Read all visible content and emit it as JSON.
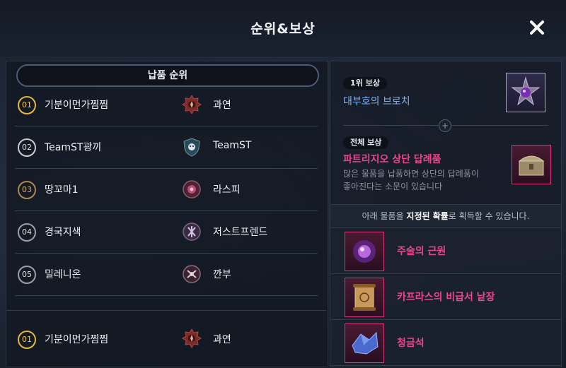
{
  "header": {
    "title": "순위&보상"
  },
  "left": {
    "ranking_title": "납품 순위",
    "rows": [
      {
        "rank": "01",
        "player": "기분이먼가찜찜",
        "guild": "과연",
        "medal": "gold"
      },
      {
        "rank": "02",
        "player": "TeamST광끼",
        "guild": "TeamST",
        "medal": "silver"
      },
      {
        "rank": "03",
        "player": "땅꼬마1",
        "guild": "라스피",
        "medal": "bronze"
      },
      {
        "rank": "04",
        "player": "경국지색",
        "guild": "저스트프렌드",
        "medal": "plain"
      },
      {
        "rank": "05",
        "player": "밀레니온",
        "guild": "깐부",
        "medal": "plain"
      }
    ],
    "my_rank": {
      "rank": "01",
      "player": "기분이먼가찜찜",
      "guild": "과연",
      "medal": "gold"
    }
  },
  "right": {
    "first_tag": "1위 보상",
    "first_reward": "대부호의 브로치",
    "all_tag": "전체 보상",
    "all_reward": "파트리지오 상단 답례품",
    "all_desc": "많은 물품을 납품하면 상단의 답례품이 좋아진다는 소문이 있습니다",
    "note_prefix": "아래 물품을 ",
    "note_bold": "지정된 확률",
    "note_suffix": "로 획득할 수 있습니다.",
    "items": [
      {
        "name": "주술의 근원",
        "icon": "purple-orb-icon"
      },
      {
        "name": "카프라스의 비급서 낱장",
        "icon": "scroll-icon"
      },
      {
        "name": "청금석",
        "icon": "crystal-icon"
      }
    ]
  },
  "colors": {
    "pink": "#e8478a",
    "blue": "#7fb2f0",
    "gold": "#e4b93a"
  }
}
